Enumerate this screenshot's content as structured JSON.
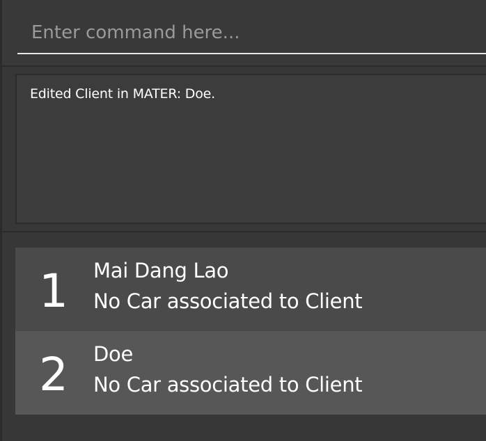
{
  "command_box": {
    "placeholder": "Enter command here...",
    "value": ""
  },
  "result_display": {
    "message": "Edited Client in MATER: Doe."
  },
  "client_list": {
    "items": [
      {
        "index": "1",
        "name": "Mai Dang Lao",
        "car": "No Car associated to Client"
      },
      {
        "index": "2",
        "name": "Doe",
        "car": "No Car associated to Client"
      }
    ]
  },
  "colors": {
    "background": "#373737",
    "card_odd": "#4a4a4a",
    "card_even": "#575757",
    "text": "#ffffff",
    "placeholder": "#9a9a9a"
  }
}
